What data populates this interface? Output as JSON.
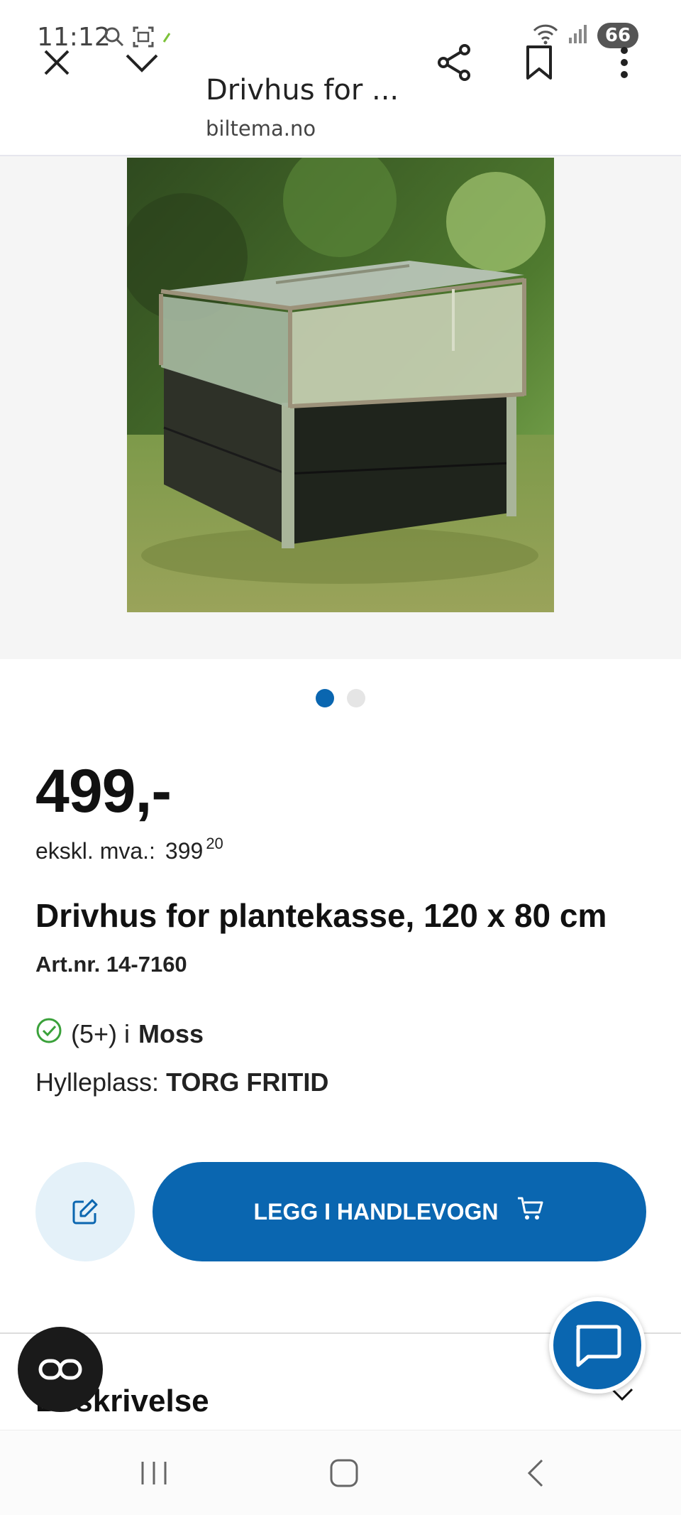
{
  "status_bar": {
    "time": "11:12",
    "battery": "66",
    "icons": [
      "search-icon",
      "screenshot-icon",
      "leaf-icon",
      "wifi-icon",
      "signal-icon",
      "battery-icon"
    ]
  },
  "browser": {
    "title": "Drivhus for ...",
    "domain": "biltema.no",
    "icons": [
      "close-icon",
      "chevron-down-icon",
      "share-icon",
      "bookmark-icon",
      "more-icon"
    ]
  },
  "gallery": {
    "image_subject": "greenhouse lid on black planter box in garden",
    "slides": 2,
    "active_slide": 1
  },
  "product": {
    "price": "499,-",
    "excl_vat_label": "ekskl. mva.:",
    "excl_vat_value": "399",
    "excl_vat_cents": "20",
    "title": "Drivhus for plantekasse, 120 x 80 cm",
    "art_nr": "Art.nr. 14-7160",
    "stock_count": "(5+) i",
    "stock_store": "Moss",
    "shelf_label": "Hylleplass:",
    "shelf_value": "TORG FRITID"
  },
  "actions": {
    "add_to_cart": "LEGG I HANDLEVOGN"
  },
  "description": {
    "heading": "Beskrivelse"
  },
  "colors": {
    "brand_blue": "#0a66b0",
    "edit_bg": "#e4f1f9",
    "stock_green": "#3aa13a"
  }
}
